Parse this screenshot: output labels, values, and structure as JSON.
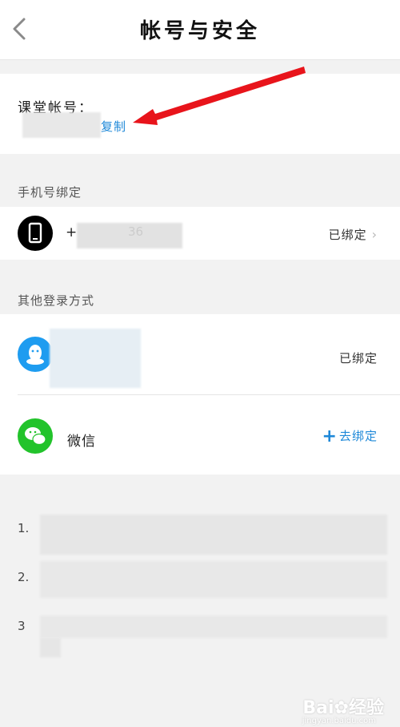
{
  "header": {
    "title": "帐号与安全",
    "back_icon": "chevron-left-icon"
  },
  "account": {
    "label": "课堂帐号：",
    "copy_label": "复制"
  },
  "phone_section": {
    "label": "手机号绑定",
    "prefix": "+",
    "partial_number": "36",
    "status": "已绑定",
    "chevron": "›",
    "icon": "phone-icon"
  },
  "other_login": {
    "label": "其他登录方式",
    "qq": {
      "status": "已绑定",
      "icon": "qq-icon",
      "color": "#1e9cf0"
    },
    "wechat": {
      "name": "微信",
      "bind_plus": "+",
      "bind_label": "去绑定",
      "icon": "wechat-icon",
      "color": "#22c32b"
    }
  },
  "notes": {
    "n1": "1.",
    "n2": "2.",
    "n3": "3"
  },
  "watermark": {
    "brand": "Bai",
    "brand2": "经验",
    "url": "jingyan.baidu.com"
  },
  "colors": {
    "link": "#1e88d8",
    "arrow": "#e8141b"
  }
}
